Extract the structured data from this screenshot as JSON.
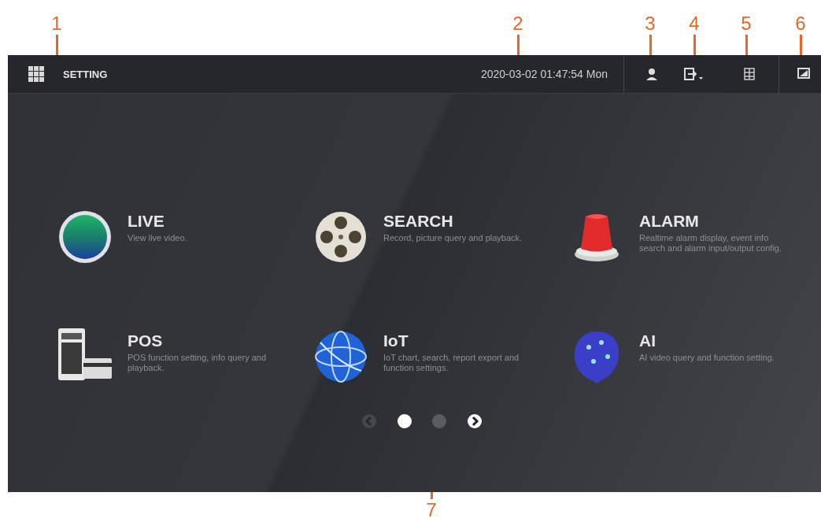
{
  "callouts": [
    "1",
    "2",
    "3",
    "4",
    "5",
    "6",
    "7"
  ],
  "top_bar": {
    "title": "SETTING",
    "datetime": "2020-03-02 01:47:54 Mon"
  },
  "tiles": [
    {
      "kind": "live",
      "title": "LIVE",
      "description": "View live video."
    },
    {
      "kind": "search",
      "title": "SEARCH",
      "description": "Record, picture query and playback."
    },
    {
      "kind": "alarm",
      "title": "ALARM",
      "description": "Realtime alarm display, event info search and alarm input/output config."
    },
    {
      "kind": "pos",
      "title": "POS",
      "description": "POS function setting, info query and playback."
    },
    {
      "kind": "iot",
      "title": "IoT",
      "description": "IoT chart, search, report export and function settings."
    },
    {
      "kind": "ai",
      "title": "AI",
      "description": "AI video query and function setting."
    }
  ],
  "pager": {
    "prev_disabled": true,
    "next_disabled": false,
    "pages": [
      {
        "selected": true
      },
      {
        "selected": false
      }
    ]
  }
}
